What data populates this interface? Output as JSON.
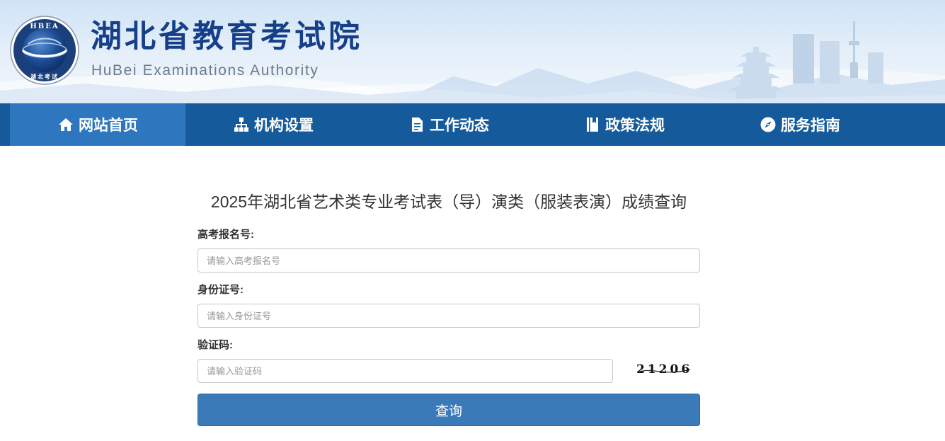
{
  "header": {
    "org_name_cn": "湖北省教育考试院",
    "org_name_en": "HuBei Examinations Authority",
    "emblem_text_top": "HBEA",
    "emblem_text_bottom": "湖北考试",
    "brand_color": "#163f8a"
  },
  "nav": {
    "items": [
      {
        "label": "网站首页",
        "icon": "home-icon",
        "active": true
      },
      {
        "label": "机构设置",
        "icon": "org-chart-icon",
        "active": false
      },
      {
        "label": "工作动态",
        "icon": "document-icon",
        "active": false
      },
      {
        "label": "政策法规",
        "icon": "book-icon",
        "active": false
      },
      {
        "label": "服务指南",
        "icon": "compass-icon",
        "active": false
      }
    ],
    "bar_color": "#155b9b",
    "active_color": "#2e76bd"
  },
  "form": {
    "title": "2025年湖北省艺术类专业考试表（导）演类（服装表演）成绩查询",
    "exam_number": {
      "label": "高考报名号:",
      "placeholder": "请输入高考报名号",
      "value": ""
    },
    "id_number": {
      "label": "身份证号:",
      "placeholder": "请输入身份证号",
      "value": ""
    },
    "captcha": {
      "label": "验证码:",
      "placeholder": "请输入验证码",
      "value": "",
      "image_text": "21206"
    },
    "submit_label": "查询",
    "button_color": "#3a7ab8"
  }
}
